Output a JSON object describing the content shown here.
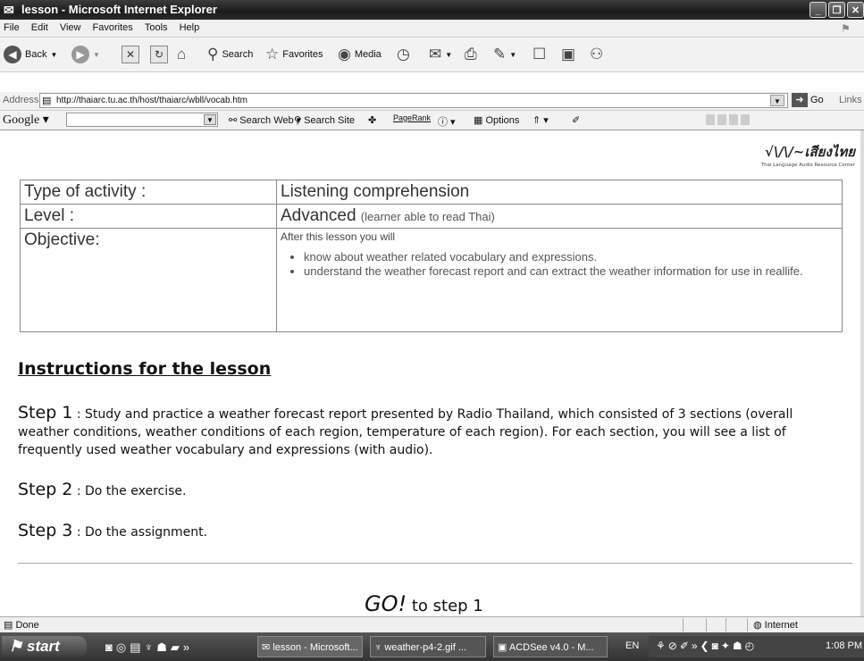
{
  "window": {
    "title": "lesson - Microsoft Internet Explorer"
  },
  "menu": [
    "File",
    "Edit",
    "View",
    "Favorites",
    "Tools",
    "Help"
  ],
  "toolbar": {
    "back": "Back",
    "search": "Search",
    "favorites": "Favorites",
    "media": "Media"
  },
  "address": {
    "label": "Address",
    "url": "http://thaiarc.tu.ac.th/host/thaiarc/wbll/vocab.htm",
    "go": "Go",
    "links": "Links"
  },
  "googlebar": {
    "logo": "Google",
    "search_web": "Search Web",
    "search_site": "Search Site",
    "pagerank": "PageRank",
    "options": "Options"
  },
  "logo": {
    "thai_text": "เสียงไทย",
    "subtitle": "Thai Language Audio Resource Center"
  },
  "info": {
    "type_label": "Type of activity :",
    "type_value": "Listening comprehension",
    "level_label": "Level :",
    "level_value": "Advanced",
    "level_note": "(learner able to read Thai)",
    "objective_label": "Objective:",
    "objective_intro": "After this lesson you will",
    "objectives": [
      "know about weather related vocabulary and expressions.",
      "understand the weather forecast report and can extract the weather information for use in reallife."
    ]
  },
  "instructions": {
    "heading": "Instructions for the lesson",
    "steps": [
      {
        "label": "Step 1",
        "text": ": Study and practice a weather forecast report presented by Radio Thailand, which consisted of 3 sections (overall weather conditions, weather conditions of each region, temperature of each region). For each section, you will see a list of frequently used weather vocabulary and expressions (with audio)."
      },
      {
        "label": "Step 2",
        "text": ": Do the exercise."
      },
      {
        "label": "Step 3",
        "text": ": Do the assignment."
      }
    ]
  },
  "go_link": {
    "go": "GO!",
    "to": "to step 1"
  },
  "status": {
    "text": "Done",
    "zone": "Internet"
  },
  "taskbar": {
    "start": "start",
    "tasks": [
      "lesson - Microsoft...",
      "weather-p4-2.gif ...",
      "ACDSee v4.0 - M..."
    ],
    "lang": "EN",
    "clock": "1:08 PM"
  }
}
